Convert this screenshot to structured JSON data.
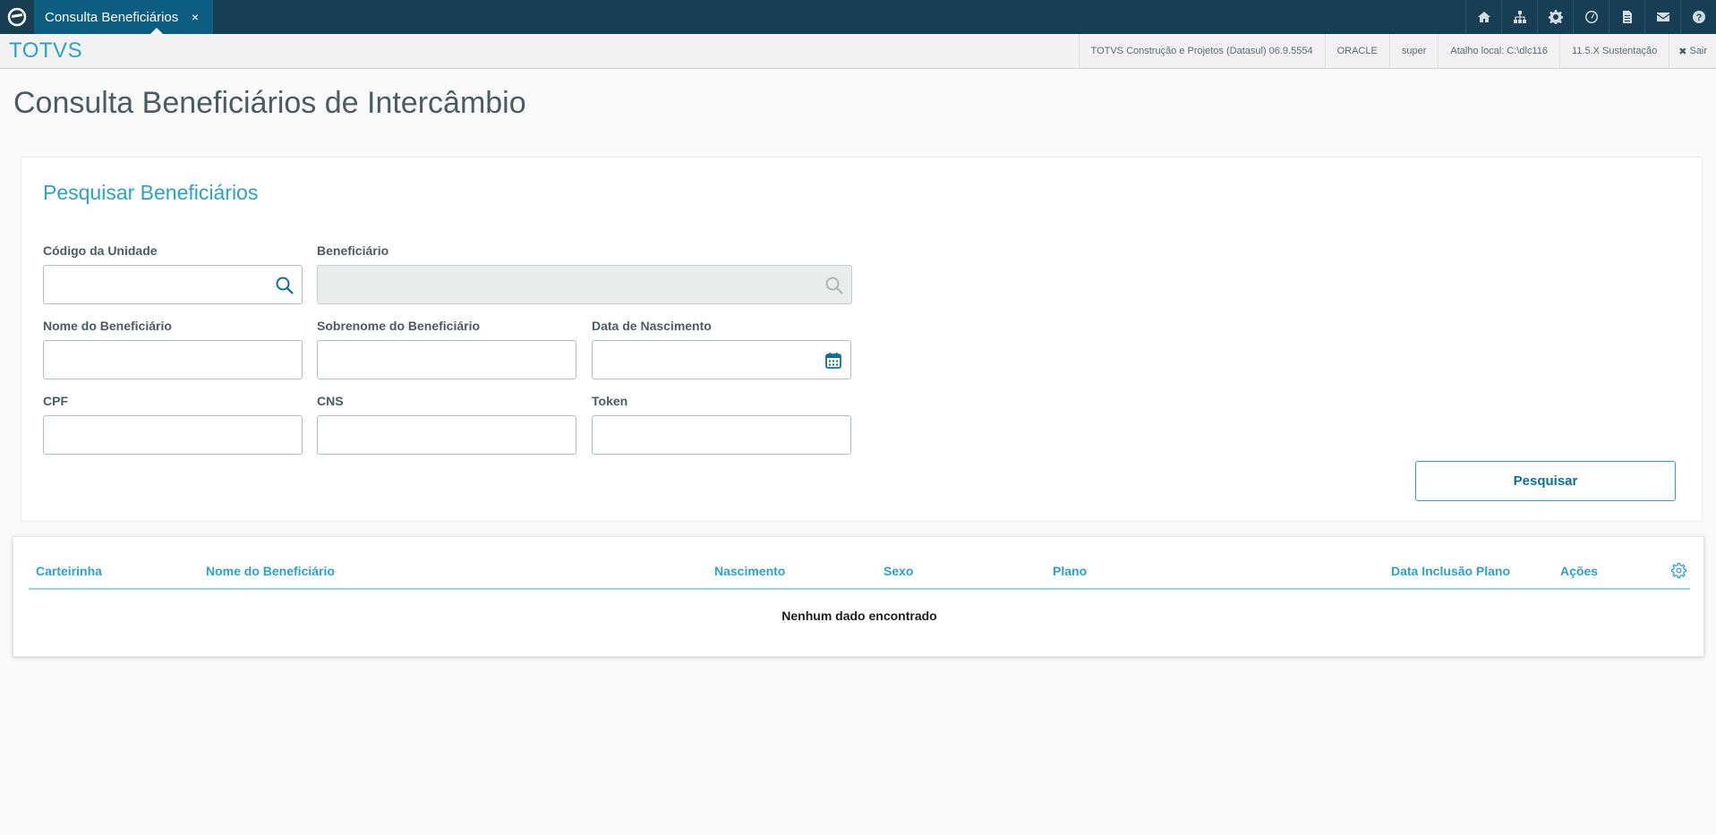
{
  "tab": {
    "title": "Consulta Beneficiários",
    "close": "×"
  },
  "infobar": {
    "brand": "TOTVS",
    "items": [
      "TOTVS Construção e Projetos (Datasul) 06.9.5554",
      "ORACLE",
      "super",
      "Atalho local: C:\\dlc116",
      "11.5.X Sustentação"
    ],
    "exit": "Sair"
  },
  "page": {
    "title": "Consulta Beneficiários de Intercâmbio"
  },
  "search": {
    "title": "Pesquisar Beneficiários",
    "fields": {
      "codigo_unidade": "Código da Unidade",
      "beneficiario": "Beneficiário",
      "nome": "Nome do Beneficiário",
      "sobrenome": "Sobrenome do Beneficiário",
      "nascimento": "Data de Nascimento",
      "cpf": "CPF",
      "cns": "CNS",
      "token": "Token"
    },
    "button": "Pesquisar"
  },
  "table": {
    "columns": [
      "Carteirinha",
      "Nome do Beneficiário",
      "Nascimento",
      "Sexo",
      "Plano",
      "Data Inclusão Plano",
      "Ações"
    ],
    "empty": "Nenhum dado encontrado"
  },
  "colors": {
    "accent": "#29a3cc",
    "topbar": "#173e52",
    "tab": "#0c5d80"
  }
}
